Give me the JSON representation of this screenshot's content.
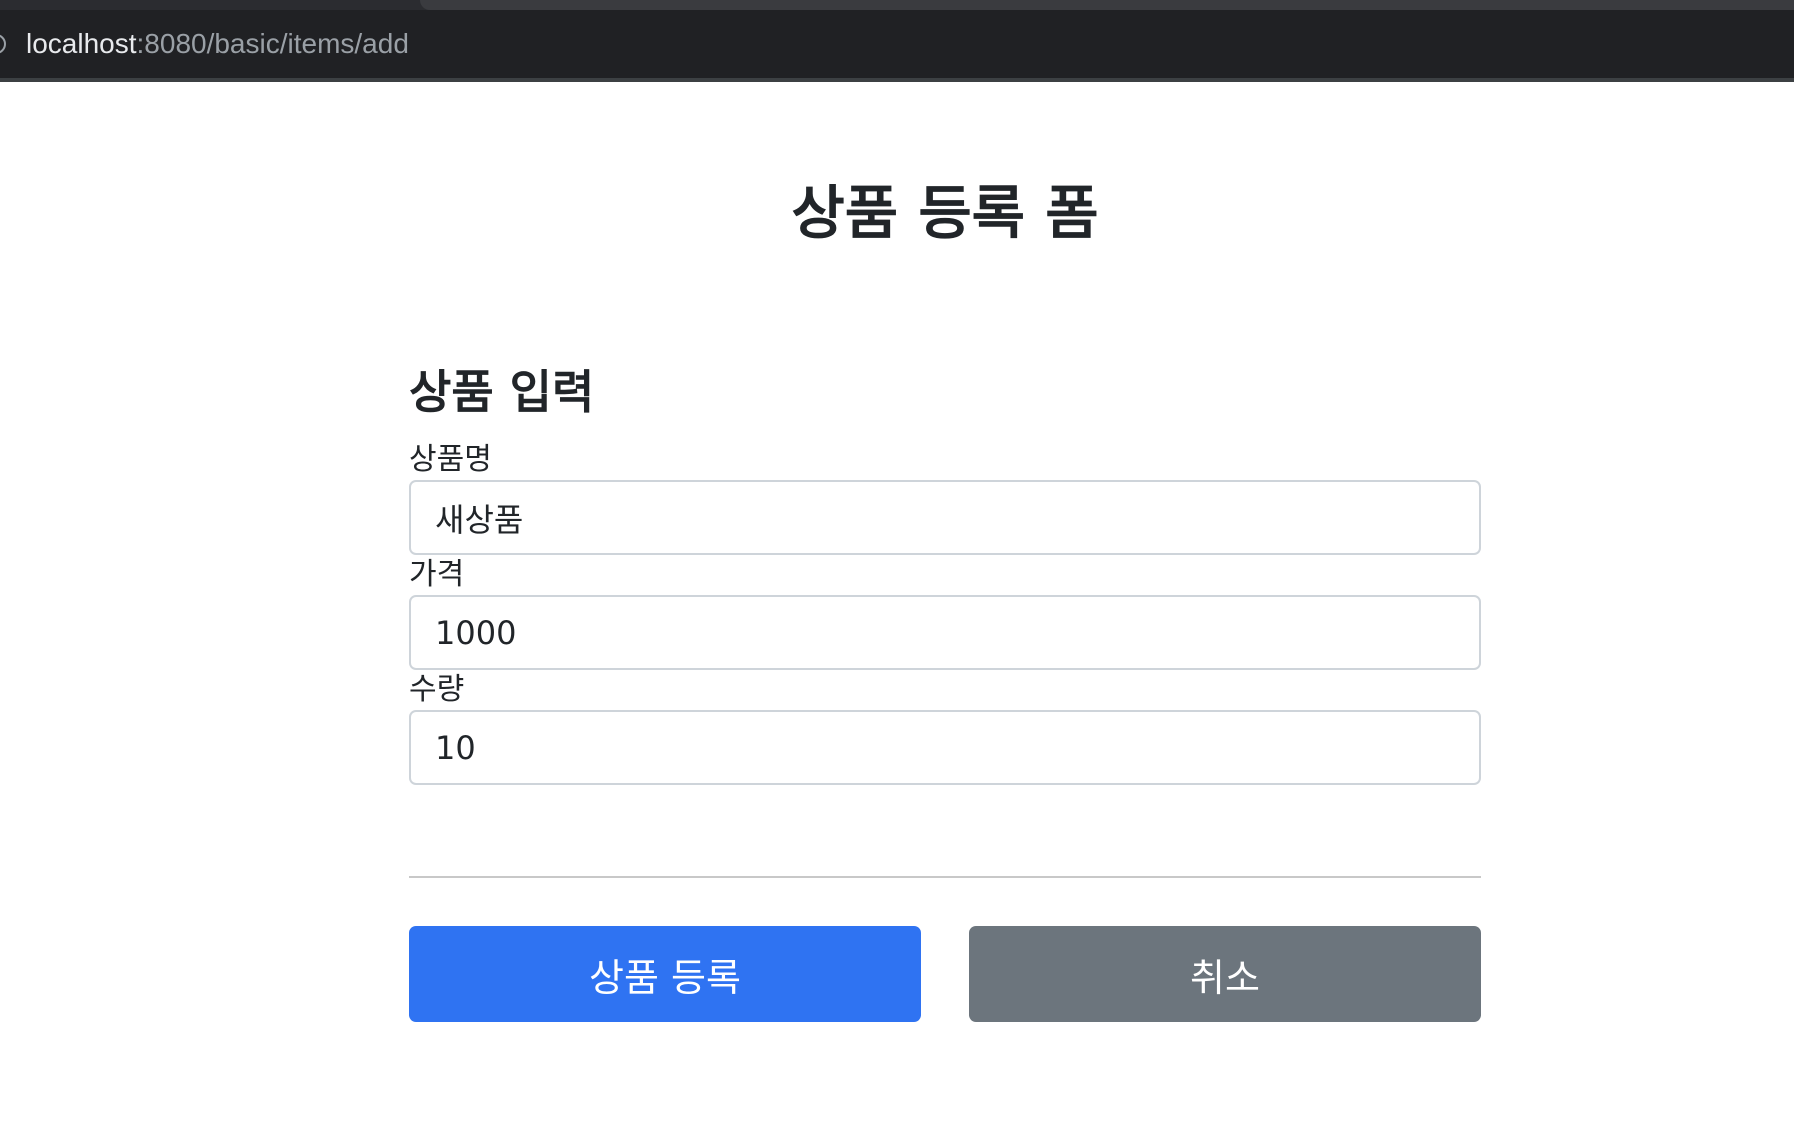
{
  "browser": {
    "url_host": "localhost",
    "url_path": ":8080/basic/items/add"
  },
  "page": {
    "title": "상품 등록 폼"
  },
  "form": {
    "section_title": "상품 입력",
    "fields": [
      {
        "label": "상품명",
        "value": "새상품"
      },
      {
        "label": "가격",
        "value": "1000"
      },
      {
        "label": "수량",
        "value": "10"
      }
    ]
  },
  "buttons": {
    "submit_label": "상품 등록",
    "cancel_label": "취소"
  },
  "colors": {
    "primary": "#2f73f2",
    "secondary": "#6c757d",
    "browser_chrome": "#202124"
  }
}
